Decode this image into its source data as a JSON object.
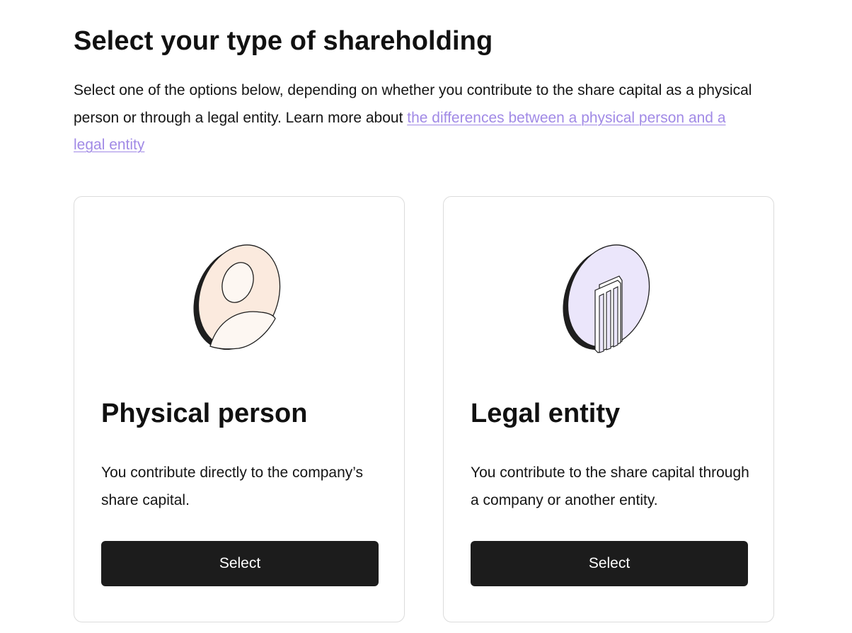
{
  "header": {
    "title": "Select your type of shareholding",
    "intro_text": "Select one of the options below, depending on whether you contribute to the share capital as a physical person or through a legal entity. Learn more about ",
    "intro_link": "the differences between a physical person and a legal entity"
  },
  "options": [
    {
      "title": "Physical person",
      "description": "You contribute directly to the company’s share capital.",
      "button_label": "Select",
      "icon": "person-coin-icon",
      "accent": "#fbeade"
    },
    {
      "title": "Legal entity",
      "description": "You contribute to the share capital through a company or another entity.",
      "button_label": "Select",
      "icon": "building-coin-icon",
      "accent": "#ebe6fb"
    }
  ],
  "colors": {
    "link": "#a18ae6",
    "button": "#1c1c1c",
    "border": "#dcdcdc"
  }
}
